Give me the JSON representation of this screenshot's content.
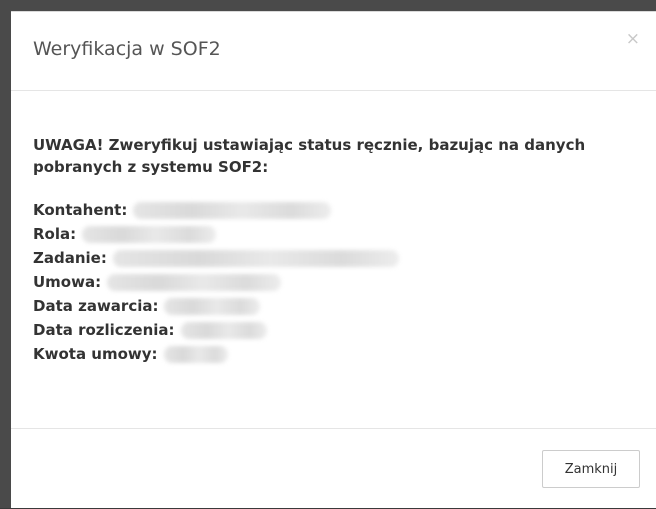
{
  "modal": {
    "title": "Weryfikacja w SOF2",
    "close_icon": "×",
    "warning": "UWAGA! Zweryfikuj ustawiając status ręcznie, bazując na danych pobranych z systemu SOF2:",
    "fields": [
      {
        "label": "Kontahent:"
      },
      {
        "label": "Rola:"
      },
      {
        "label": "Zadanie:"
      },
      {
        "label": "Umowa:"
      },
      {
        "label": "Data zawarcia:"
      },
      {
        "label": "Data rozliczenia:"
      },
      {
        "label": "Kwota umowy:"
      }
    ],
    "close_button_label": "Zamknij"
  },
  "icons": {
    "close": "close-icon"
  },
  "colors": {
    "title": "#555555",
    "text": "#333333",
    "border": "#e5e5e5",
    "backdrop": "#4a4a4a"
  }
}
